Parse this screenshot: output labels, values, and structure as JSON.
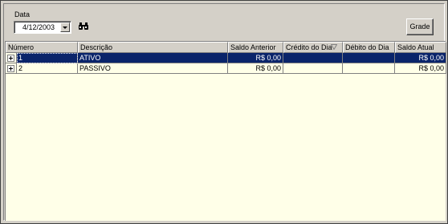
{
  "filters": {
    "date_label": "Data",
    "date_value": "4/12/2003"
  },
  "toolbar": {
    "grade_label": "Grade"
  },
  "grid": {
    "columns": [
      "Número",
      "Descrição",
      "Saldo Anterior",
      "Crédito do Dia",
      "Débito do Dia",
      "Saldo Atual"
    ],
    "rows": [
      {
        "numero": "1",
        "descricao": "ATIVO",
        "saldo_anterior": "R$ 0,00",
        "credito": "",
        "debito": "",
        "saldo_atual": "R$ 0,00",
        "selected": true
      },
      {
        "numero": "2",
        "descricao": "PASSIVO",
        "saldo_anterior": "R$ 0,00",
        "credito": "",
        "debito": "",
        "saldo_atual": "R$ 0,00",
        "selected": false
      }
    ]
  },
  "colors": {
    "selection": "#0a246a",
    "grid_background": "#ffffe8",
    "window_face": "#d4d0c8"
  },
  "icons": {
    "search": "binoculars-icon",
    "sort": "sort-descending-icon",
    "expand": "plus-box-icon"
  }
}
